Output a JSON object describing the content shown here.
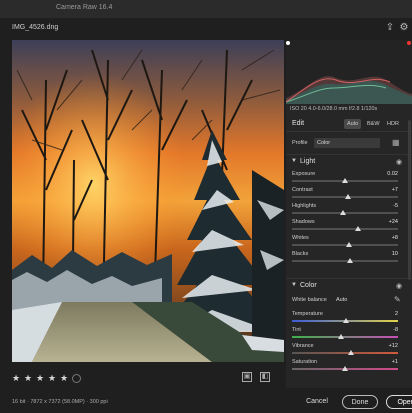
{
  "app": {
    "title": "Camera Raw 16.4",
    "filename": "IMG_4526.dng"
  },
  "image": {
    "alt": "Winter sunset scene with snow-covered trees and a path"
  },
  "camera_info": "ISO 20  4.0-6.0/28.0 mm  f/2.8  1/120s",
  "edit": {
    "label": "Edit",
    "modes": [
      "Auto",
      "B&W",
      "HDR"
    ],
    "active_mode": "Auto",
    "profile_label": "Profile",
    "profile_value": "Color"
  },
  "light": {
    "title": "Light",
    "sliders": [
      {
        "label": "Exposure",
        "value": "0.02",
        "pos": 0.5
      },
      {
        "label": "Contrast",
        "value": "+7",
        "pos": 0.53
      },
      {
        "label": "Highlights",
        "value": "-5",
        "pos": 0.48
      },
      {
        "label": "Shadows",
        "value": "+24",
        "pos": 0.62
      },
      {
        "label": "Whites",
        "value": "+8",
        "pos": 0.54
      },
      {
        "label": "Blacks",
        "value": "10",
        "pos": 0.55
      }
    ]
  },
  "color": {
    "title": "Color",
    "wb_label": "White balance",
    "wb_value": "Auto",
    "sliders": [
      {
        "label": "Temperature",
        "value": "2",
        "pos": 0.51
      },
      {
        "label": "Tint",
        "value": "-8",
        "pos": 0.46
      },
      {
        "label": "Vibrance",
        "value": "+12",
        "pos": 0.56
      },
      {
        "label": "Saturation",
        "value": "+1",
        "pos": 0.5
      }
    ]
  },
  "rating": {
    "stars": 5
  },
  "status_info": "16 bit · 7872 x 7372 (58.0MP) · 300 ppi",
  "buttons": {
    "cancel": "Cancel",
    "done": "Done",
    "open": "Open"
  },
  "colors": {
    "accent": "#e0e0e0",
    "panel": "#262626",
    "bg": "#1f1f1f"
  }
}
